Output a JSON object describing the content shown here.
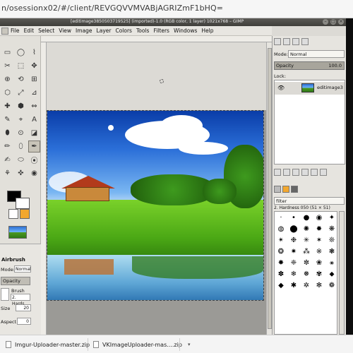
{
  "browser": {
    "url": "n/osessionx02/#/client/REVGQVVMVABjAGRIZmF1bHQ="
  },
  "window": {
    "title": "[editimage3850503719525] (imported)-1.0 (RGB color, 1 layer) 1021x768 – GIMP"
  },
  "menu": {
    "items": [
      "File",
      "Edit",
      "Select",
      "View",
      "Image",
      "Layer",
      "Colors",
      "Tools",
      "Filters",
      "Windows",
      "Help"
    ]
  },
  "toolbox": {
    "tools": [
      "▭",
      "◯",
      "⌇",
      "✂",
      "⬚",
      "✥",
      "⊕",
      "⟲",
      "⊞",
      "⬡",
      "⤢",
      "⊿",
      "✚",
      "⬢",
      "⇔",
      "✎",
      "⌖",
      "A",
      "⬮",
      "⊙",
      "◪",
      "✏",
      "⬯",
      "✒",
      "✍",
      "⬭",
      "⦿",
      "⚘",
      "✜",
      "◉"
    ],
    "selected_index": 23
  },
  "tool_options": {
    "title": "Airbrush",
    "mode_label": "Mode:",
    "mode_value": "Normal",
    "opacity_label": "Opacity",
    "brush_label": "Brush",
    "brush_value": "2. Hards",
    "size_label": "Size",
    "size_value": "20",
    "aspect_label": "Aspect",
    "aspect_value": "0"
  },
  "layers_panel": {
    "mode_label": "Mode:",
    "mode_value": "Normal",
    "opacity_label": "Opacity",
    "opacity_value": "100.0",
    "lock_label": "Lock:",
    "layer_name": "editimage3"
  },
  "brushes_panel": {
    "filter_placeholder": "filter",
    "brush_caption": "2. Hardness 050 (51 × 51)",
    "brushes": [
      "·",
      "•",
      "●",
      "◉",
      "✦",
      "◍",
      "⬤",
      "✺",
      "✹",
      "❋",
      "✴",
      "❉",
      "✳",
      "✶",
      "❊",
      "❂",
      "✷",
      "⁂",
      "※",
      "❃",
      "✸",
      "❈",
      "✼",
      "❀",
      "⚹",
      "✽",
      "❄",
      "❅",
      "✾",
      "⬥",
      "◆",
      "✱",
      "✲",
      "✻",
      "❁"
    ]
  },
  "downloads": [
    {
      "name": "Imgur-Uploader-master.zip"
    },
    {
      "name": "VKImageUploader-mas....zip"
    }
  ],
  "colors": {
    "fg": "#000000",
    "bg": "#ffffff",
    "accent": "#f2a72e"
  }
}
